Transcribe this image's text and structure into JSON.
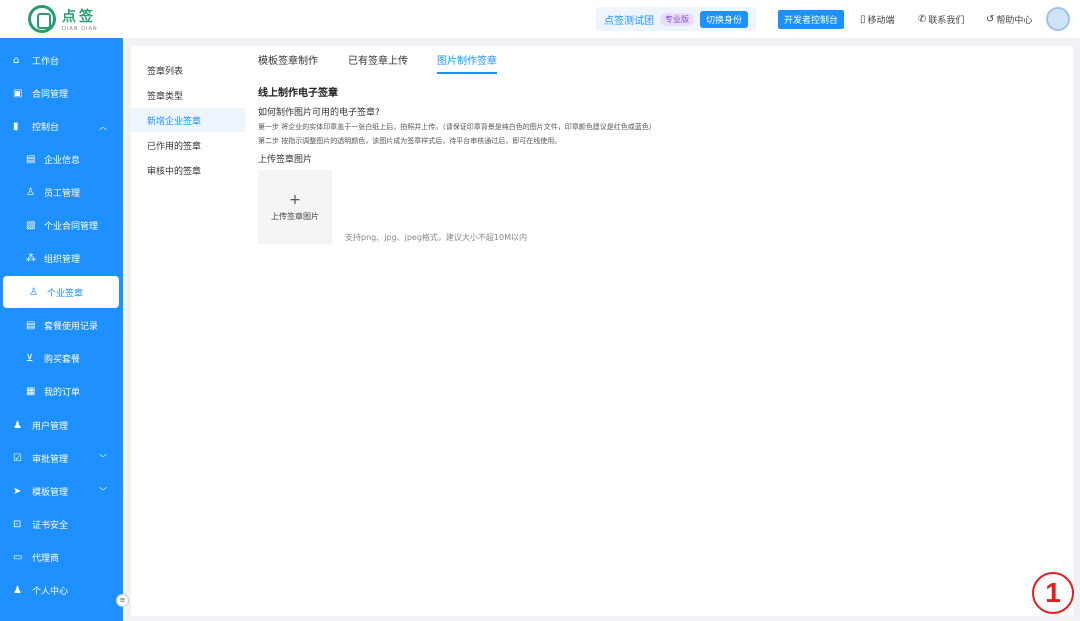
{
  "header": {
    "logo_text": "点签",
    "logo_sub": "DIAN QIAN",
    "company": "点签测试团",
    "pro_badge": "专业版",
    "switch_identity": "切换身份",
    "dev_console": "开发者控制台",
    "links": [
      {
        "label": "移动端",
        "icon": "mobile-icon"
      },
      {
        "label": "联系我们",
        "icon": "phone-icon"
      },
      {
        "label": "帮助中心",
        "icon": "help-icon"
      }
    ]
  },
  "sidebar": {
    "items": [
      {
        "label": "工作台",
        "icon": "home-icon"
      },
      {
        "label": "合同管理",
        "icon": "contract-icon"
      },
      {
        "label": "控制台",
        "icon": "chart-icon"
      },
      {
        "label": "企业信息",
        "icon": "doc-icon"
      },
      {
        "label": "员工管理",
        "icon": "user-icon"
      },
      {
        "label": "个业合同管理",
        "icon": "file-icon"
      },
      {
        "label": "组织管理",
        "icon": "org-icon"
      },
      {
        "label": "个业签章",
        "icon": "seal-icon"
      },
      {
        "label": "套餐使用记录",
        "icon": "record-icon"
      },
      {
        "label": "购买套餐",
        "icon": "cart-icon"
      },
      {
        "label": "我的订单",
        "icon": "order-icon"
      },
      {
        "label": "用户管理",
        "icon": "user-manage-icon"
      },
      {
        "label": "审批管理",
        "icon": "approval-icon"
      },
      {
        "label": "模板管理",
        "icon": "template-icon"
      },
      {
        "label": "证书安全",
        "icon": "lock-icon"
      },
      {
        "label": "代理商",
        "icon": "agent-icon"
      },
      {
        "label": "个人中心",
        "icon": "person-icon"
      }
    ]
  },
  "subnav": {
    "items": [
      "签章列表",
      "签章类型",
      "新增企业签章",
      "已作用的签章",
      "审核中的签章"
    ]
  },
  "tabs": [
    "模板签章制作",
    "已有签章上传",
    "图片制作签章"
  ],
  "content": {
    "title": "线上制作电子签章",
    "question": "如何制作图片可用的电子签章?",
    "step1": "第一步    将企业的实体印章盖于一张白纸上后，拍照并上传。（请保证印章背景是纯白色的图片文件，印章颜色建议是红色或蓝色）",
    "step2": "第二步    按指示调整图片的透明颜色，该图片成为签章样式后，待平台审核通过后，即可在线使用。",
    "upload_label": "上传签章图片",
    "upload_plus": "+",
    "upload_button": "上传签章图片",
    "upload_hint": "支持png、jpg、jpeg格式，建议大小不超10M以内"
  },
  "badge_number": "1"
}
